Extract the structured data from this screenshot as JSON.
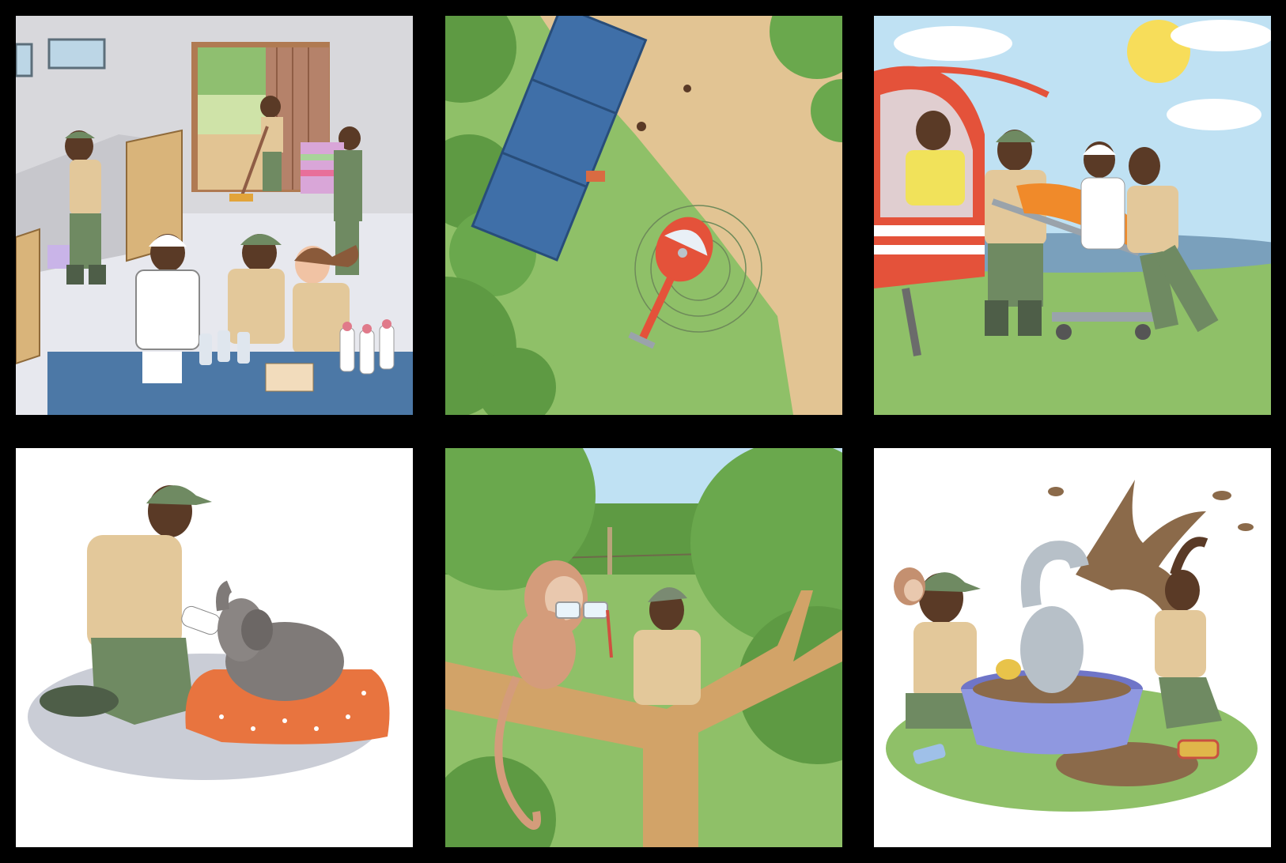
{
  "page": {
    "background_color": "#000000",
    "panel_count": 6
  },
  "panels": [
    {
      "id": "nursery-kitchen",
      "icon": "nursery-scene"
    },
    {
      "id": "aerial-landing",
      "icon": "helicopter-aerial-scene"
    },
    {
      "id": "helicopter-rescue",
      "icon": "stretcher-rescue-scene"
    },
    {
      "id": "bottle-feeding",
      "icon": "baby-elephant-feeding-scene"
    },
    {
      "id": "monkey-tree",
      "icon": "monkey-on-branch-scene"
    },
    {
      "id": "mud-bath",
      "icon": "elephant-mud-bath-scene"
    }
  ],
  "colors": {
    "ranger_uniform": "#6f8a62",
    "ranger_shirt": "#e3c89a",
    "skin": "#5a3a26",
    "grass": "#8fc068",
    "sky": "#bfe1f3",
    "helicopter_red": "#e4523a",
    "elephant_grey": "#9aa3ab",
    "monkey_tan": "#d49c7b",
    "mud_brown": "#8b6a4a",
    "tub_blue": "#8f98e0",
    "cushion_orange": "#e8743f"
  }
}
